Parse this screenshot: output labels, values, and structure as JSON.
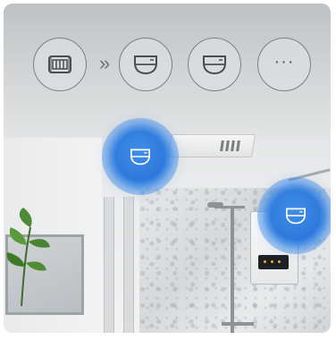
{
  "toolbar": {
    "buttons": [
      {
        "name": "fan-panel-icon"
      },
      {
        "name": "bath-heater-icon"
      },
      {
        "name": "bath-heater-icon-2"
      }
    ],
    "chevron": "»",
    "more_label": "···"
  },
  "hotspots": [
    {
      "name": "ceiling-heater-hotspot",
      "icon": "bath-heater-icon"
    },
    {
      "name": "wall-heater-hotspot",
      "icon": "bath-heater-icon"
    }
  ],
  "colors": {
    "accent": "#2b78dc",
    "icon_stroke": "#4a4e51"
  }
}
